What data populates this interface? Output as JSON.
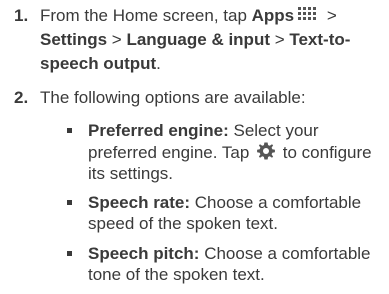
{
  "steps": [
    {
      "number": "1.",
      "part1": "From the Home screen, tap ",
      "apps_label": "Apps",
      "sep1": " > ",
      "settings_label": "Settings",
      "sep2": " > ",
      "language_label": "Language & input",
      "sep3": " > ",
      "tts_label": "Text-to-speech output",
      "end": ".",
      "apps_icon": "apps-grid-icon"
    },
    {
      "number": "2.",
      "text": "The following options are available:"
    }
  ],
  "options": [
    {
      "term": "Preferred engine:",
      "desc_before": " Select your preferred engine. Tap ",
      "desc_after": " to configure its settings.",
      "icon": "gear-icon"
    },
    {
      "term": "Speech rate:",
      "desc": " Choose a comfortable speed of the spoken text."
    },
    {
      "term": "Speech pitch:",
      "desc": " Choose a comfortable tone of the spoken text."
    }
  ],
  "colors": {
    "text": "#3a3a3a",
    "icon": "#555555"
  }
}
